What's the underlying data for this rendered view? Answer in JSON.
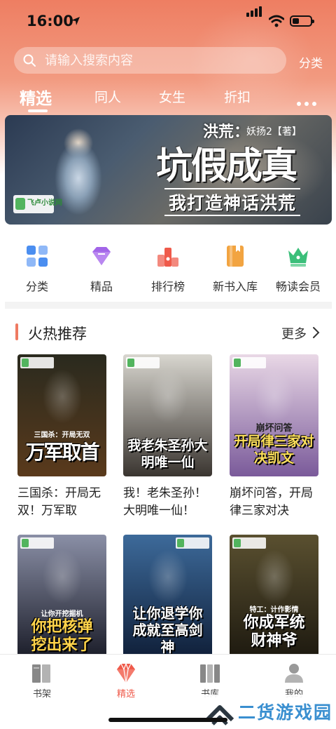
{
  "status_bar": {
    "time": "16:00"
  },
  "search": {
    "placeholder": "请输入搜索内容",
    "category_label": "分类"
  },
  "top_tabs": [
    {
      "label": "精选",
      "active": true
    },
    {
      "label": "同人",
      "active": false
    },
    {
      "label": "女生",
      "active": false
    },
    {
      "label": "折扣",
      "active": false
    }
  ],
  "banner": {
    "subtitle": "洪荒：",
    "author": "妖扬2【著】",
    "title": "坑假成真",
    "slogan": "我打造神话洪荒",
    "logo_text": "飞卢小说网"
  },
  "quick_nav": [
    {
      "label": "分类",
      "icon": "grid-icon",
      "color": "#4b8ef0"
    },
    {
      "label": "精品",
      "icon": "diamond-icon",
      "color": "#a265e8"
    },
    {
      "label": "排行榜",
      "icon": "ranking-icon",
      "color": "#ef5a4a"
    },
    {
      "label": "新书入库",
      "icon": "new-book-icon",
      "color": "#f2a441"
    },
    {
      "label": "畅读会员",
      "icon": "crown-icon",
      "color": "#3bbf7a"
    }
  ],
  "hot_section": {
    "title": "火热推荐",
    "more_label": "更多"
  },
  "books": [
    {
      "name": "三国杀：开局无双！万军取",
      "cover_title": "万军取首",
      "cover_tag": "三国杀：开局无双",
      "cover_color_top": "#2a2a1e",
      "cover_color_bottom": "#5a3a1c"
    },
    {
      "name": "我！老朱圣孙！大明唯一仙！",
      "cover_title": "我老朱圣孙大明唯一仙",
      "cover_tag": "",
      "cover_color_top": "#d8d6cf",
      "cover_color_bottom": "#3a3530"
    },
    {
      "name": "崩坏问答，开局律三家对决",
      "cover_title": "开局律三家对决凯文",
      "cover_tag": "崩坏问答",
      "cover_color_top": "#e9d8e6",
      "cover_color_bottom": "#7a5a9a"
    },
    {
      "name": "",
      "cover_title": "你把核弹挖出来了",
      "cover_tag": "让你开挖掘机",
      "cover_color_top": "#8a8fa6",
      "cover_color_bottom": "#1c1e2a"
    },
    {
      "name": "",
      "cover_title": "让你退学你成就至高剑神",
      "cover_tag": "",
      "cover_color_top": "#3d6a9a",
      "cover_color_bottom": "#10203a"
    },
    {
      "name": "",
      "cover_title": "你成军统财神爷",
      "cover_tag": "特工：计作影情",
      "cover_color_top": "#5a5030",
      "cover_color_bottom": "#1e1a10"
    }
  ],
  "bottom_nav": [
    {
      "label": "书架",
      "active": false
    },
    {
      "label": "精选",
      "active": true
    },
    {
      "label": "书库",
      "active": false
    },
    {
      "label": "我的",
      "active": false
    }
  ],
  "watermark": {
    "text": "二货游戏园"
  },
  "colors": {
    "accent": "#ef7a62",
    "active_nav": "#ef5a4a"
  }
}
